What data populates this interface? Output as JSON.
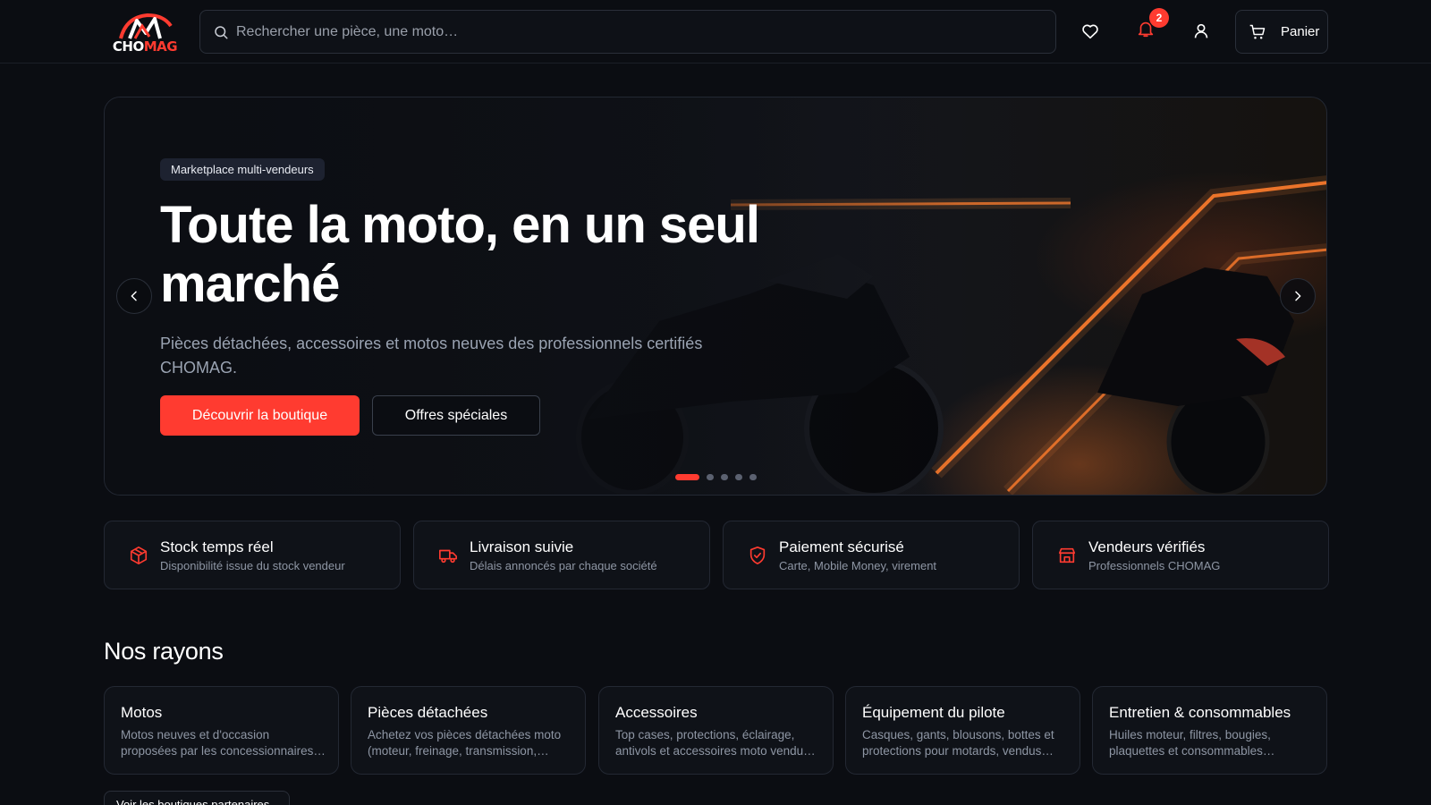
{
  "brand": {
    "logo_part1": "CHO",
    "logo_part2": "MAG",
    "accent_color": "#ff3b30"
  },
  "header": {
    "search_placeholder": "Rechercher une pièce, une moto…",
    "notification_count": "2",
    "cart_label": "Panier"
  },
  "hero": {
    "tag": "Marketplace multi-vendeurs",
    "title": "Toute la moto, en un seul marché",
    "subtitle": "Pièces détachées, accessoires et motos neuves des professionnels certifiés CHOMAG.",
    "primary_cta": "Découvrir la boutique",
    "secondary_cta": "Offres spéciales",
    "slides_total": 5,
    "active_slide": 1
  },
  "features": [
    {
      "icon": "box-icon",
      "title": "Stock temps réel",
      "desc": "Disponibilité issue du stock vendeur"
    },
    {
      "icon": "truck-icon",
      "title": "Livraison suivie",
      "desc": "Délais annoncés par chaque société"
    },
    {
      "icon": "shield-check-icon",
      "title": "Paiement sécurisé",
      "desc": "Carte, Mobile Money, virement"
    },
    {
      "icon": "store-icon",
      "title": "Vendeurs vérifiés",
      "desc": "Professionnels CHOMAG"
    }
  ],
  "rayons": {
    "title": "Nos rayons",
    "items": [
      {
        "title": "Motos",
        "desc": "Motos neuves et d'occasion proposées par les concessionnaires…"
      },
      {
        "title": "Pièces détachées",
        "desc": "Achetez vos pièces détachées moto (moteur, freinage, transmission,…"
      },
      {
        "title": "Accessoires",
        "desc": "Top cases, protections, éclairage, antivols et accessoires moto vendu…"
      },
      {
        "title": "Équipement du pilote",
        "desc": "Casques, gants, blousons, bottes et protections pour motards, vendus…"
      },
      {
        "title": "Entretien & consommables",
        "desc": "Huiles moteur, filtres, bougies, plaquettes et consommables…"
      }
    ],
    "partners_button": "Voir les boutiques partenaires"
  }
}
